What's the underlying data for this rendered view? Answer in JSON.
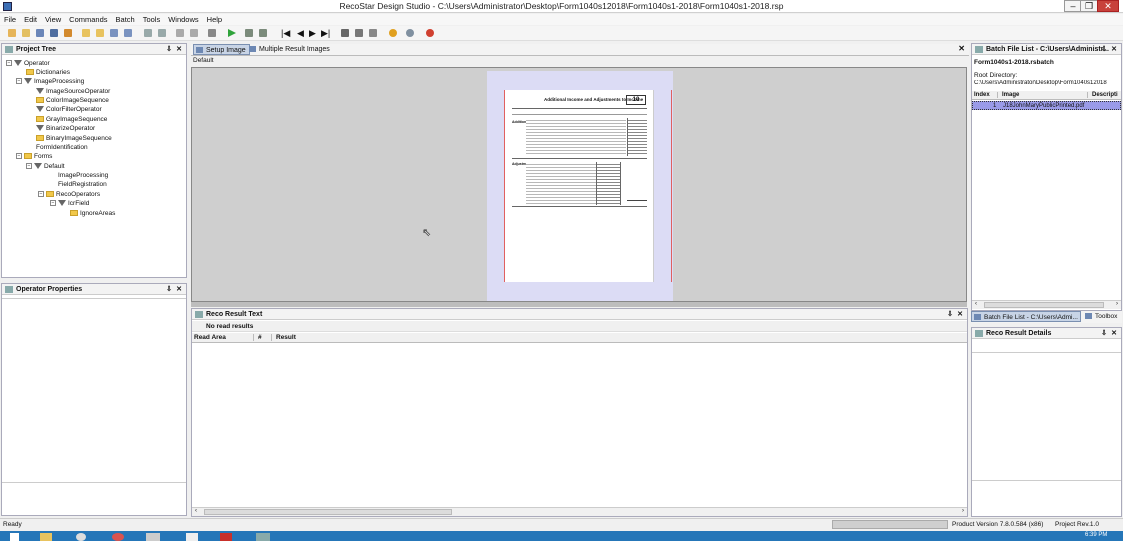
{
  "window": {
    "title": "RecoStar Design Studio - C:\\Users\\Administrator\\Desktop\\Form1040s12018\\Form1040s1-2018\\Form1040s1-2018.rsp"
  },
  "menu": [
    "File",
    "Edit",
    "View",
    "Commands",
    "Batch",
    "Tools",
    "Windows",
    "Help"
  ],
  "project_tree": {
    "title": "Project Tree",
    "nodes": [
      "Operator",
      "Dictionaries",
      "ImageProcessing",
      "ImageSourceOperator",
      "ColorImageSequence",
      "ColorFilterOperator",
      "GrayImageSequence",
      "BinarizeOperator",
      "BinaryImageSequence",
      "FormIdentification",
      "Forms",
      "Default",
      "ImageProcessing",
      "FieldRegistration",
      "RecoOperators",
      "IcrField",
      "IgnoreAreas"
    ]
  },
  "operator_properties": {
    "title": "Operator Properties"
  },
  "editor": {
    "tabs": [
      "Setup Image",
      "Multiple Result Images"
    ],
    "form_label": "Default",
    "doc": {
      "title": "Additional Income and Adjustments to Income",
      "form_number": "10",
      "sections": [
        "Additional Income",
        "Adjustments to Income"
      ]
    }
  },
  "reco_result": {
    "title": "Reco Result Text",
    "status": "No read results",
    "columns": [
      "Read Area",
      "#",
      "Result"
    ]
  },
  "batch": {
    "title": "Batch File List - C:\\Users\\Administr...",
    "file": "Form1040s1-2018.rsbatch",
    "root_label": "Root Directory:",
    "root_path": "C:\\Users\\Administrator\\Desktop\\Form1040s12018",
    "columns": [
      "Index",
      "Image",
      "Descripti"
    ],
    "rows": [
      {
        "index": "1",
        "image": "J18JohnMaryPublicPrinted.pdf"
      }
    ],
    "bottom_tabs": [
      "Batch File List - C:\\Users\\Admi...",
      "Toolbox"
    ]
  },
  "reco_details": {
    "title": "Reco Result Details"
  },
  "status": {
    "left": "Ready",
    "version": "Product Version 7.8.0.584 (x86)",
    "rev": "Project Rev.1.0"
  },
  "taskbar": {
    "time": "6:39 PM"
  },
  "colors": {
    "accent": "#3d6fb5",
    "selection": "#9a9be8",
    "taskbar": "#2576b8",
    "close": "#c8413b"
  }
}
